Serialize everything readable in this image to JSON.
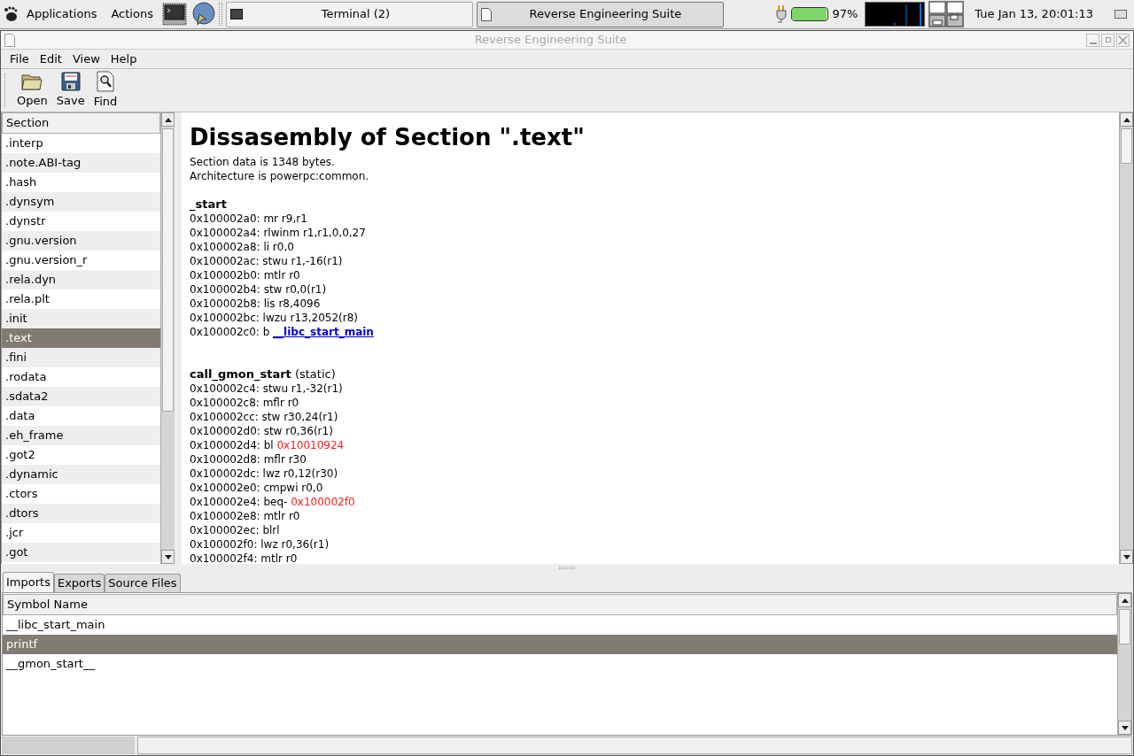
{
  "panel": {
    "menus": [
      "Applications",
      "Actions"
    ],
    "tasks": [
      {
        "label": "Terminal (2)",
        "selected": false
      },
      {
        "label": "Reverse Engineering Suite",
        "selected": true
      }
    ],
    "battery": {
      "level": 0.97,
      "reading": "97%"
    },
    "clock": "Tue Jan 13, 20:01:13"
  },
  "window": {
    "title": "Reverse Engineering Suite"
  },
  "menubar": [
    "File",
    "Edit",
    "View",
    "Help"
  ],
  "toolbar": [
    {
      "kind": "open",
      "label": "Open"
    },
    {
      "kind": "save",
      "label": "Save"
    },
    {
      "kind": "find",
      "label": "Find"
    }
  ],
  "sections": {
    "header": "Section",
    "items": [
      {
        "label": ".interp",
        "selected": false
      },
      {
        "label": ".note.ABI-tag",
        "selected": false
      },
      {
        "label": ".hash",
        "selected": false
      },
      {
        "label": ".dynsym",
        "selected": false
      },
      {
        "label": ".dynstr",
        "selected": false
      },
      {
        "label": ".gnu.version",
        "selected": false
      },
      {
        "label": ".gnu.version_r",
        "selected": false
      },
      {
        "label": ".rela.dyn",
        "selected": false
      },
      {
        "label": ".rela.plt",
        "selected": false
      },
      {
        "label": ".init",
        "selected": false
      },
      {
        "label": ".text",
        "selected": true
      },
      {
        "label": ".fini",
        "selected": false
      },
      {
        "label": ".rodata",
        "selected": false
      },
      {
        "label": ".sdata2",
        "selected": false
      },
      {
        "label": ".data",
        "selected": false
      },
      {
        "label": ".eh_frame",
        "selected": false
      },
      {
        "label": ".got2",
        "selected": false
      },
      {
        "label": ".dynamic",
        "selected": false
      },
      {
        "label": ".ctors",
        "selected": false
      },
      {
        "label": ".dtors",
        "selected": false
      },
      {
        "label": ".jcr",
        "selected": false
      },
      {
        "label": ".got",
        "selected": false
      }
    ]
  },
  "disassembly": {
    "title": "Dissasembly of Section \".text\"",
    "info": [
      "Section data is 1348 bytes.",
      "Architecture is powerpc:common."
    ],
    "functions": [
      {
        "name": "_start",
        "lines": [
          {
            "text": "0x100002a0: mr r9,r1"
          },
          {
            "text": "0x100002a4: rlwinm r1,r1,0,0,27"
          },
          {
            "text": "0x100002a8: li r0,0"
          },
          {
            "text": "0x100002ac: stwu r1,-16(r1)"
          },
          {
            "text": "0x100002b0: mtlr r0"
          },
          {
            "text": "0x100002b4: stw r0,0(r1)"
          },
          {
            "text": "0x100002b8: lis r8,4096"
          },
          {
            "text": "0x100002bc: lwzu r13,2052(r8)"
          },
          {
            "text": "0x100002c0: b",
            "ref": {
              "kind": "symbol",
              "text": "__libc_start_main"
            }
          }
        ]
      },
      {
        "name": "call_gmon_start",
        "note": "(static)",
        "lines": [
          {
            "text": "0x100002c4: stwu r1,-32(r1)"
          },
          {
            "text": "0x100002c8: mflr r0"
          },
          {
            "text": "0x100002cc: stw r30,24(r1)"
          },
          {
            "text": "0x100002d0: stw r0,36(r1)"
          },
          {
            "text": "0x100002d4: bl",
            "ref": {
              "kind": "address",
              "text": "0x10010924"
            }
          },
          {
            "text": "0x100002d8: mflr r30"
          },
          {
            "text": "0x100002dc: lwz r0,12(r30)"
          },
          {
            "text": "0x100002e0: cmpwi r0,0"
          },
          {
            "text": "0x100002e4: beq-",
            "ref": {
              "kind": "address",
              "text": "0x100002f0"
            }
          },
          {
            "text": "0x100002e8: mtlr r0"
          },
          {
            "text": "0x100002ec: blrl"
          },
          {
            "text": "0x100002f0: lwz r0,36(r1)"
          },
          {
            "text": "0x100002f4: mtlr r0"
          }
        ]
      }
    ]
  },
  "bottom_tabs": [
    {
      "label": "Imports",
      "selected": true
    },
    {
      "label": "Exports",
      "selected": false
    },
    {
      "label": "Source Files",
      "selected": false
    }
  ],
  "symbols": {
    "header": "Symbol Name",
    "rows": [
      {
        "name": "__libc_start_main",
        "selected": false
      },
      {
        "name": "printf",
        "selected": true
      },
      {
        "name": "__gmon_start__",
        "selected": false
      }
    ]
  }
}
